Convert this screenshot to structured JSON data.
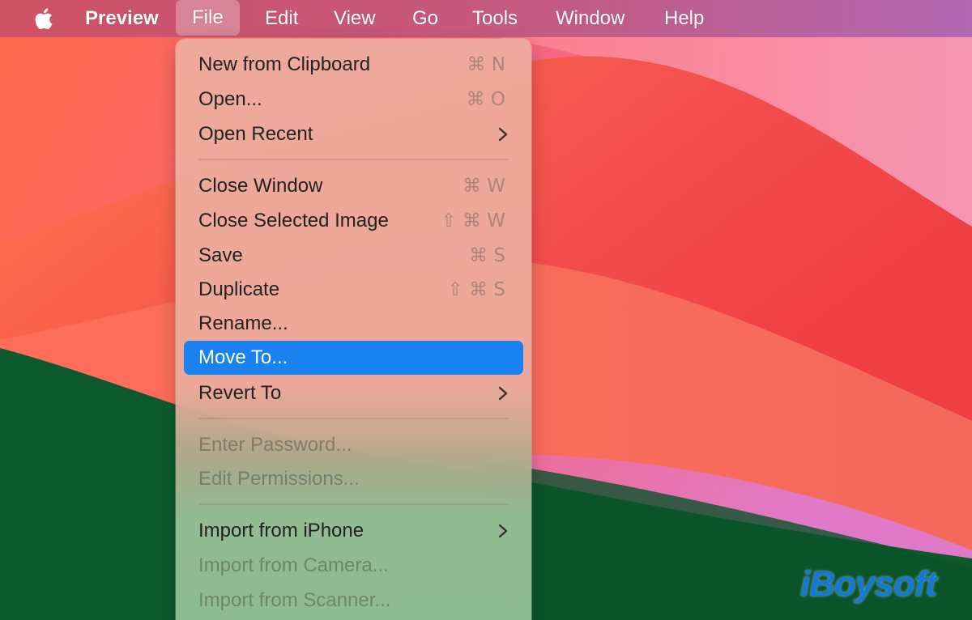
{
  "menubar": {
    "app_name": "Preview",
    "items": [
      "File",
      "Edit",
      "View",
      "Go",
      "Tools",
      "Window",
      "Help"
    ],
    "active_item": "File"
  },
  "file_menu": {
    "items": [
      {
        "label": "New from Clipboard",
        "shortcut": "⌘ N"
      },
      {
        "label": "Open...",
        "shortcut": "⌘ O"
      },
      {
        "label": "Open Recent",
        "submenu": true
      },
      {
        "label": "Close Window",
        "shortcut": "⌘ W"
      },
      {
        "label": "Close Selected Image",
        "shortcut": "⇧ ⌘ W"
      },
      {
        "label": "Save",
        "shortcut": "⌘ S"
      },
      {
        "label": "Duplicate",
        "shortcut": "⇧ ⌘ S"
      },
      {
        "label": "Rename..."
      },
      {
        "label": "Move To...",
        "selected": true
      },
      {
        "label": "Revert To",
        "submenu": true
      },
      {
        "label": "Enter Password...",
        "disabled": true
      },
      {
        "label": "Edit Permissions...",
        "disabled": true
      },
      {
        "label": "Import from iPhone",
        "submenu": true
      },
      {
        "label": "Import from Camera...",
        "disabled": true
      },
      {
        "label": "Import from Scanner...",
        "disabled": true
      }
    ]
  },
  "watermark": "iBoysoft",
  "icons": {
    "apple": "apple-logo-icon",
    "chevron": "chevron-right-icon"
  },
  "colors": {
    "selection": "#1a82f0",
    "wallpaper_red": "#f4555a",
    "wallpaper_green": "#0d5a2e",
    "watermark": "#1478d8"
  }
}
